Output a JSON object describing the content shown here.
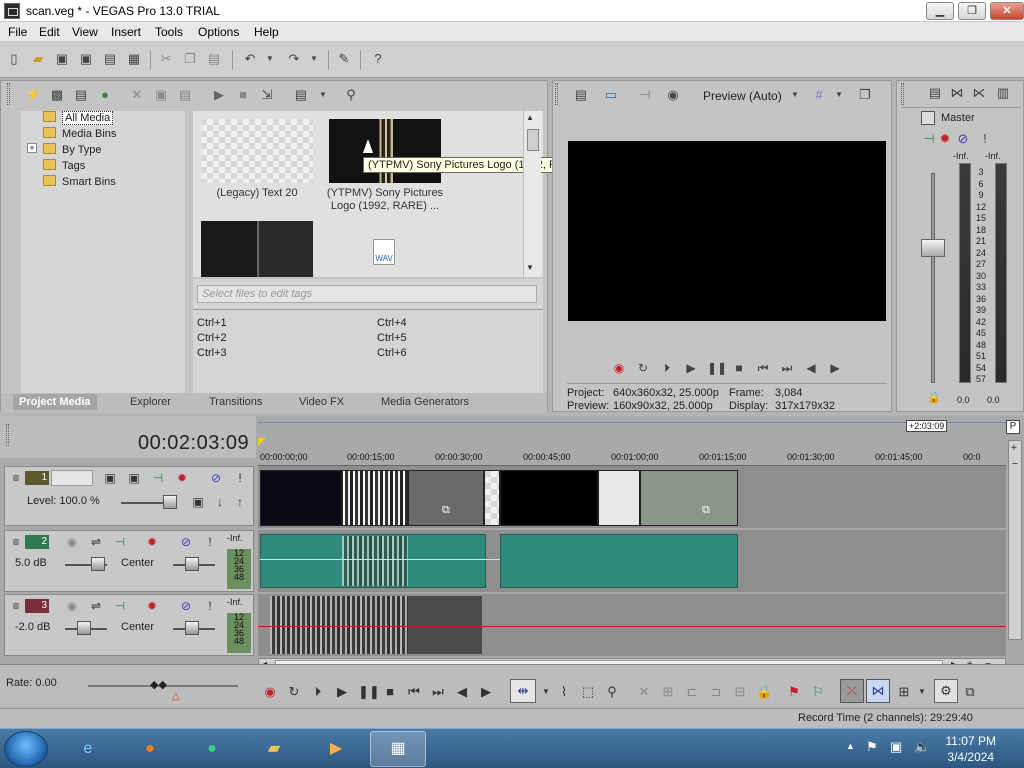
{
  "window": {
    "title": "scan.veg * - VEGAS Pro 13.0 TRIAL",
    "min_label": "▁",
    "max_label": "❐",
    "close_label": "✕"
  },
  "menu": [
    "File",
    "Edit",
    "View",
    "Insert",
    "Tools",
    "Options",
    "Help"
  ],
  "toolbar_icons": [
    "new-icon",
    "open-icon",
    "save-icon",
    "save-as-icon",
    "render-icon",
    "cut-icon",
    "copy-icon",
    "paste-icon",
    "undo-icon",
    "redo-icon",
    "paint-icon",
    "help-icon"
  ],
  "media_tree": {
    "items": [
      {
        "label": "All Media",
        "selected": true
      },
      {
        "label": "Media Bins"
      },
      {
        "label": "By Type",
        "expandable": true,
        "expander": "+"
      },
      {
        "label": "Tags"
      },
      {
        "label": "Smart Bins"
      }
    ]
  },
  "media": {
    "items": [
      {
        "caption": "(Legacy) Text 20",
        "type": "text"
      },
      {
        "caption": "(YTPMV) Sony Pictures Logo (1992, RARE) ...",
        "type": "video"
      },
      {
        "caption": "",
        "type": "video-dark"
      },
      {
        "caption": "",
        "type": "wav",
        "badge": "WAV"
      }
    ],
    "tooltip": "(YTPMV) Sony Pictures Logo (1992, RARE) Scan.mp4",
    "tag_placeholder": "Select files to edit tags",
    "shortcuts_left": [
      "Ctrl+1",
      "Ctrl+2",
      "Ctrl+3"
    ],
    "shortcuts_right": [
      "Ctrl+4",
      "Ctrl+5",
      "Ctrl+6"
    ]
  },
  "media_tabs": [
    "Project Media",
    "Explorer",
    "Transitions",
    "Video FX",
    "Media Generators"
  ],
  "preview": {
    "mode": "Preview (Auto)",
    "project_label": "Project:",
    "project_value": "640x360x32, 25.000p",
    "preview_label": "Preview:",
    "preview_value": "160x90x32, 25.000p",
    "frame_label": "Frame:",
    "frame_value": "3,084",
    "display_label": "Display:",
    "display_value": "317x179x32"
  },
  "master": {
    "label": "Master",
    "left_peak": "-Inf.",
    "right_peak": "-Inf.",
    "scale": [
      "3",
      "6",
      "9",
      "12",
      "15",
      "18",
      "21",
      "24",
      "27",
      "30",
      "33",
      "36",
      "39",
      "42",
      "45",
      "48",
      "51",
      "54",
      "57"
    ],
    "bottom_left": "0.0",
    "bottom_right": "0.0"
  },
  "timeline": {
    "timecode": "00:02:03:09",
    "end_marker": "+2:03:09",
    "ruler": [
      "00:00:00;00",
      "00:00:15;00",
      "00:00:30;00",
      "00:00:45;00",
      "00:01:00;00",
      "00:01:15;00",
      "00:01:30;00",
      "00:01:45;00",
      "00:0"
    ],
    "tracks": [
      {
        "num": "1",
        "type": "video",
        "level_label": "Level: 100.0 %"
      },
      {
        "num": "2",
        "type": "audio",
        "vol": "5.0 dB",
        "pan": "Center",
        "peak": "-Inf.",
        "levels": [
          "12",
          "24",
          "36",
          "48"
        ]
      },
      {
        "num": "3",
        "type": "audio",
        "vol": "-2.0 dB",
        "pan": "Center",
        "peak": "-Inf.",
        "levels": [
          "12",
          "24",
          "36",
          "48"
        ]
      }
    ]
  },
  "transport": {
    "rate": "Rate: 0.00"
  },
  "status": {
    "record_time": "Record Time (2 channels): 29:29:40"
  },
  "taskbar": {
    "apps": [
      "start-orb",
      "ie-icon",
      "firefox-icon",
      "app-green-icon",
      "explorer-icon",
      "media-player-icon",
      "vegas-icon"
    ],
    "time": "11:07 PM",
    "date": "3/4/2024"
  },
  "colors": {
    "accent": "#2e8b7a",
    "video_track": "#5a5a2e",
    "audio_track2": "#2f7a50",
    "audio_track3": "#7a2d3a",
    "record": "#c8202a"
  }
}
